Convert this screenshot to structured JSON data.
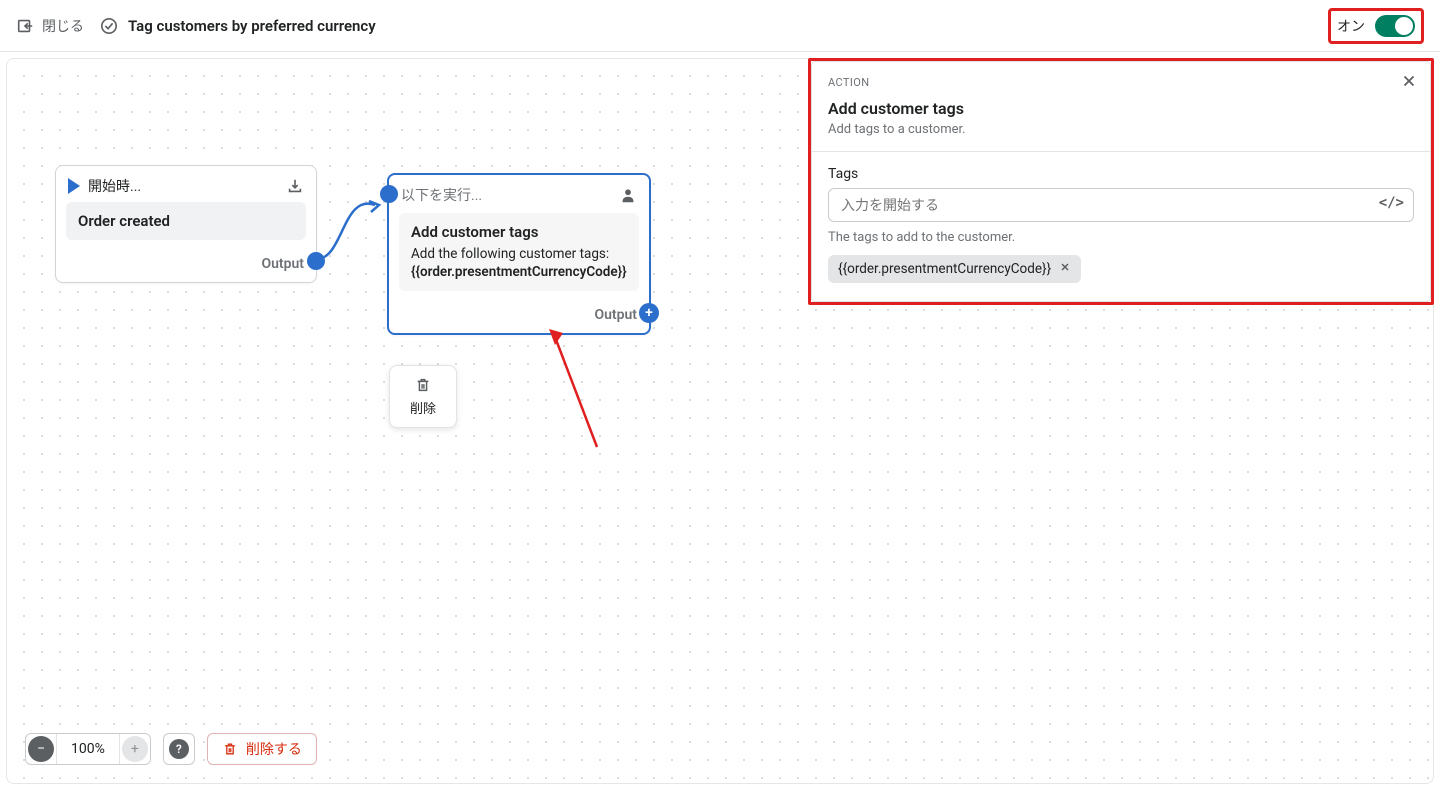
{
  "header": {
    "close_label": "閉じる",
    "title": "Tag customers by preferred currency",
    "toggle_label": "オン"
  },
  "canvas": {
    "trigger_node": {
      "head_label": "開始時...",
      "body": "Order created",
      "output_label": "Output"
    },
    "action_node": {
      "head_label": "以下を実行...",
      "title": "Add customer tags",
      "desc_prefix": "Add the following customer tags:",
      "desc_value": "{{order.presentmentCurrencyCode}}",
      "output_label": "Output"
    },
    "delete_popup": "削除"
  },
  "bottom": {
    "zoom": "100%",
    "delete_label": "削除する"
  },
  "panel": {
    "eyebrow": "ACTION",
    "title": "Add customer tags",
    "subtitle": "Add tags to a customer.",
    "field_label": "Tags",
    "input_placeholder": "入力を開始する",
    "help_text": "The tags to add to the customer.",
    "chip_value": "{{order.presentmentCurrencyCode}}"
  }
}
